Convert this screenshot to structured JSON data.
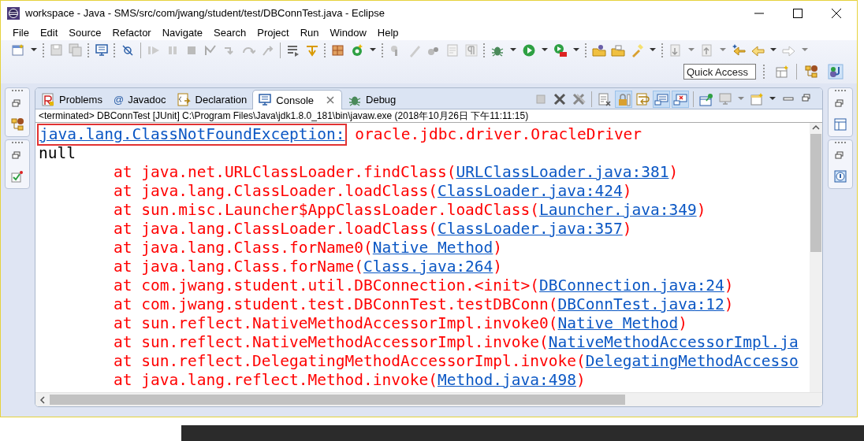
{
  "window": {
    "title": "workspace - Java - SMS/src/com/jwang/student/test/DBConnTest.java - Eclipse"
  },
  "menu": [
    {
      "label": "File"
    },
    {
      "label": "Edit"
    },
    {
      "label": "Source"
    },
    {
      "label": "Refactor"
    },
    {
      "label": "Navigate"
    },
    {
      "label": "Search"
    },
    {
      "label": "Project"
    },
    {
      "label": "Run"
    },
    {
      "label": "Window"
    },
    {
      "label": "Help"
    }
  ],
  "quick_access": {
    "placeholder": "Quick Access"
  },
  "tabs": [
    {
      "label": "Problems",
      "selected": false
    },
    {
      "label": "Javadoc",
      "glyph": "@",
      "selected": false
    },
    {
      "label": "Declaration",
      "selected": false
    },
    {
      "label": "Console",
      "selected": true
    },
    {
      "label": "Debug",
      "selected": false
    }
  ],
  "console": {
    "status": "<terminated> DBConnTest [JUnit] C:\\Program Files\\Java\\jdk1.8.0_181\\bin\\javaw.exe (2018年10月26日 下午11:11:15)",
    "lines": [
      {
        "kind": "exception",
        "link": "java.lang.ClassNotFoundException:",
        "highlighted": true,
        "text": " oracle.jdbc.driver.OracleDriver"
      },
      {
        "kind": "output",
        "text": "null"
      },
      {
        "kind": "frame",
        "text": "at java.net.URLClassLoader.findClass(",
        "link": "URLClassLoader.java:381",
        "tail": ")"
      },
      {
        "kind": "frame",
        "text": "at java.lang.ClassLoader.loadClass(",
        "link": "ClassLoader.java:424",
        "tail": ")"
      },
      {
        "kind": "frame",
        "text": "at sun.misc.Launcher$AppClassLoader.loadClass(",
        "link": "Launcher.java:349",
        "tail": ")"
      },
      {
        "kind": "frame",
        "text": "at java.lang.ClassLoader.loadClass(",
        "link": "ClassLoader.java:357",
        "tail": ")"
      },
      {
        "kind": "frame",
        "text": "at java.lang.Class.forName0(",
        "link": "Native Method",
        "tail": ")"
      },
      {
        "kind": "frame",
        "text": "at java.lang.Class.forName(",
        "link": "Class.java:264",
        "tail": ")"
      },
      {
        "kind": "frame",
        "text": "at com.jwang.student.util.DBConnection.<init>(",
        "link": "DBConnection.java:24",
        "tail": ")"
      },
      {
        "kind": "frame",
        "text": "at com.jwang.student.test.DBConnTest.testDBConn(",
        "link": "DBConnTest.java:12",
        "tail": ")"
      },
      {
        "kind": "frame",
        "text": "at sun.reflect.NativeMethodAccessorImpl.invoke0(",
        "link": "Native Method",
        "tail": ")"
      },
      {
        "kind": "frame",
        "text": "at sun.reflect.NativeMethodAccessorImpl.invoke(",
        "link": "NativeMethodAccessorImpl.ja"
      },
      {
        "kind": "frame",
        "text": "at sun.reflect.DelegatingMethodAccessorImpl.invoke(",
        "link": "DelegatingMethodAccesso"
      },
      {
        "kind": "frame",
        "text": "at java.lang.reflect.Method.invoke(",
        "link": "Method.java:498",
        "tail": ")"
      }
    ]
  }
}
